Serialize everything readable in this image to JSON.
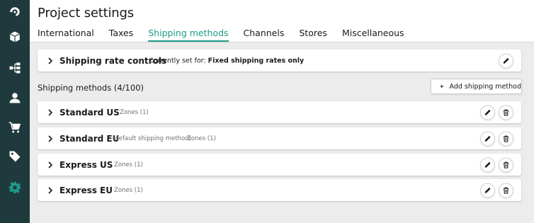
{
  "header": {
    "title": "Project settings",
    "tabs": [
      {
        "label": "International"
      },
      {
        "label": "Taxes"
      },
      {
        "label": "Shipping methods"
      },
      {
        "label": "Channels"
      },
      {
        "label": "Stores"
      },
      {
        "label": "Miscellaneous"
      }
    ],
    "active_tab": "Shipping methods"
  },
  "nav_rail": {
    "icons": [
      "logo-icon",
      "box-icon",
      "hierarchy-icon",
      "user-icon",
      "cart-icon",
      "tags-icon",
      "gear-icon"
    ],
    "active_icon": "gear-icon"
  },
  "rate_controls": {
    "title": "Shipping rate controls",
    "current_prefix": "Currently set for:",
    "current_value": "Fixed shipping rates only"
  },
  "methods": {
    "section_label": "Shipping methods (4/100)",
    "add_button_label": "Add shipping method",
    "items": [
      {
        "name": "Standard US",
        "note": "",
        "zones": "Zones (1)"
      },
      {
        "name": "Standard EU",
        "note": "(default shipping method)",
        "zones": "Zones (1)"
      },
      {
        "name": "Express US",
        "note": "",
        "zones": "Zones (1)"
      },
      {
        "name": "Express EU",
        "note": "",
        "zones": "Zones (1)"
      }
    ]
  },
  "colors": {
    "rail": "#1f3a3d",
    "accent": "#1d9b8a",
    "background": "#ececec"
  }
}
